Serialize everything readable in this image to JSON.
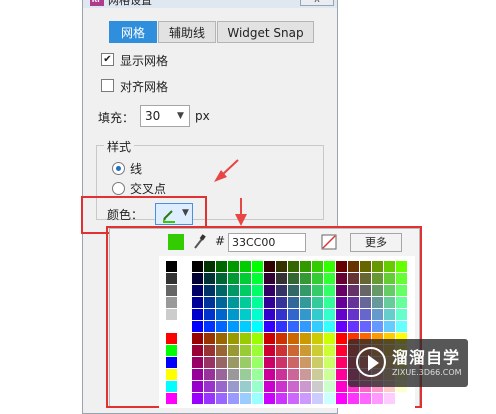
{
  "dialog": {
    "title": "网格设置",
    "logo": "RP",
    "close_label": "X"
  },
  "tabs": [
    {
      "label": "网格",
      "active": true
    },
    {
      "label": "辅助线",
      "active": false
    },
    {
      "label": "Widget Snap",
      "active": false
    }
  ],
  "grid": {
    "show_grid_label": "显示网格",
    "show_grid_checked": "✔",
    "snap_grid_label": "对齐网格",
    "fill_label": "填充：",
    "fill_value": "30",
    "fill_unit": "px",
    "style_group_label": "样式",
    "style_line_label": "线",
    "style_cross_label": "交叉点",
    "color_label": "颜色：",
    "color_icon": "pencil-icon",
    "current_color": "#33CC00"
  },
  "color_picker": {
    "hash": "#",
    "hex_value": "33CC00",
    "more_label": "更多",
    "preview_color": "#33CC00",
    "icons": [
      "eyedropper-icon",
      "no-color-icon"
    ]
  },
  "watermark": {
    "title": "溜溜自学",
    "subtitle": "ZIXUE.3D66.COM"
  },
  "colors": {
    "accent": "#2f8fdc",
    "highlight": "#e03232",
    "arrow": "#e84545"
  }
}
